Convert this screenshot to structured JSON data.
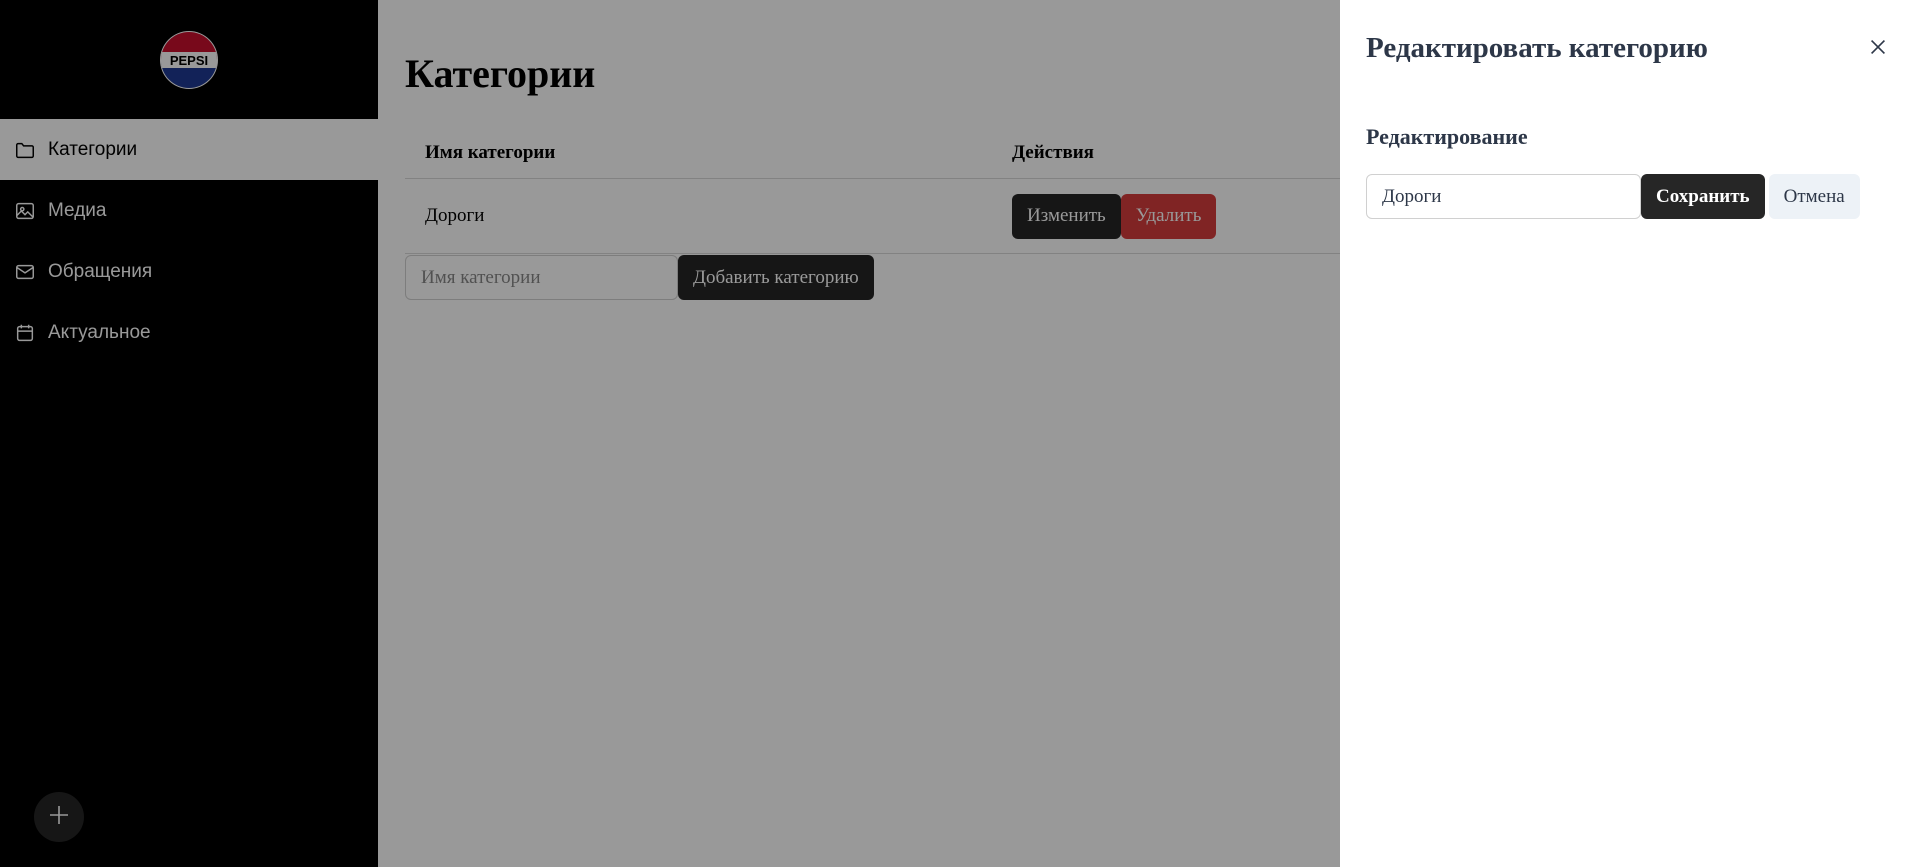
{
  "brand": {
    "logo_text": "PEPSI"
  },
  "sidebar": {
    "items": [
      {
        "label": "Категории",
        "icon": "folder-icon",
        "active": true
      },
      {
        "label": "Медиа",
        "icon": "image-icon",
        "active": false
      },
      {
        "label": "Обращения",
        "icon": "mail-icon",
        "active": false
      },
      {
        "label": "Актуальное",
        "icon": "calendar-icon",
        "active": false
      }
    ],
    "fab_icon": "plus-icon"
  },
  "main": {
    "title": "Категории",
    "table": {
      "columns": [
        "Имя категории",
        "Действия"
      ],
      "rows": [
        {
          "name": "Дороги",
          "edit_label": "Изменить",
          "delete_label": "Удалить"
        }
      ]
    },
    "add": {
      "placeholder": "Имя категории",
      "button_label": "Добавить категорию"
    }
  },
  "drawer": {
    "title": "Редактировать категорию",
    "section_title": "Редактирование",
    "input_value": "Дороги",
    "save_label": "Сохранить",
    "cancel_label": "Отмена",
    "close_icon": "close-icon"
  },
  "colors": {
    "sidebar_bg": "#000000",
    "dark_button": "#262626",
    "danger": "#d63c3c",
    "heading": "#2d3748",
    "overlay": "rgba(0,0,0,0.4)"
  }
}
